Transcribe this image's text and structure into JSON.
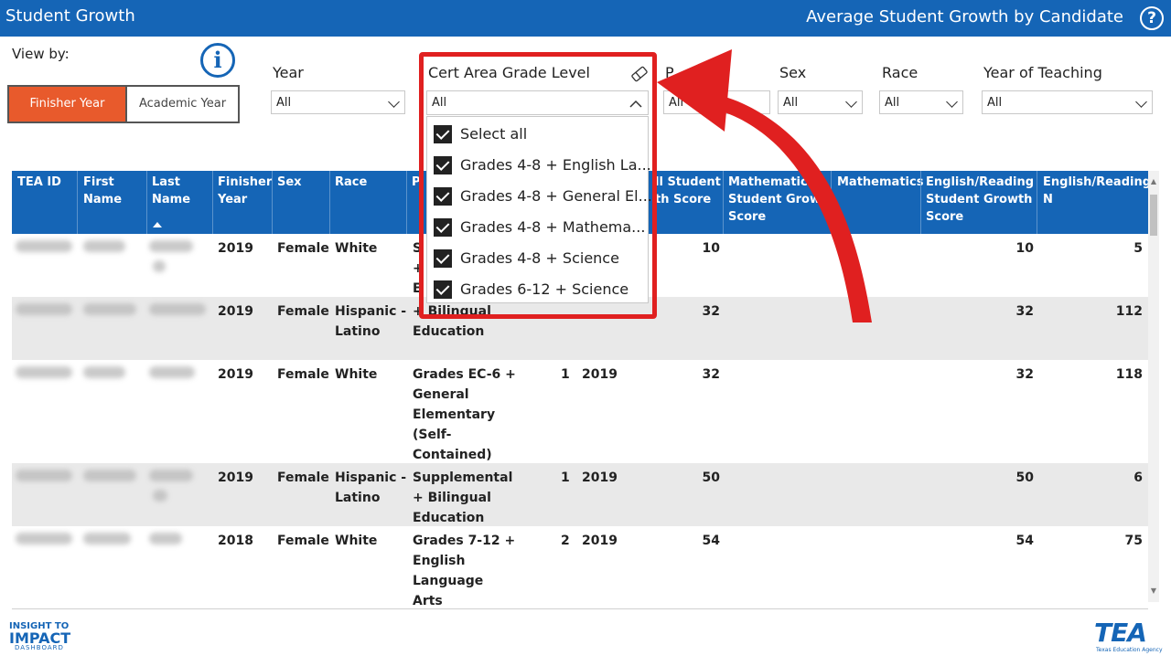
{
  "header": {
    "app_title": "Student Growth",
    "report_title": "Average Student Growth by Candidate",
    "help_glyph": "?"
  },
  "view_by": {
    "label": "View by:",
    "info_glyph": "i",
    "options": [
      {
        "label": "Finisher Year",
        "selected": true
      },
      {
        "label": "Academic Year",
        "selected": false
      }
    ]
  },
  "filters": {
    "year": {
      "label": "Year",
      "value": "All"
    },
    "cert_area": {
      "label": "Cert Area Grade Level",
      "value": "All"
    },
    "hidden_filter": {
      "label": "P",
      "value": "All"
    },
    "sex": {
      "label": "Sex",
      "value": "All"
    },
    "race": {
      "label": "Race",
      "value": "All"
    },
    "year_of_teaching": {
      "label": "Year of Teaching",
      "value": "All"
    }
  },
  "dropdown": {
    "items": [
      {
        "label": "Select all",
        "checked": true
      },
      {
        "label": "Grades 4-8 + English La...",
        "checked": true
      },
      {
        "label": "Grades 4-8 + General El...",
        "checked": true
      },
      {
        "label": "Grades 4-8 + Mathema...",
        "checked": true
      },
      {
        "label": "Grades 4-8 + Science",
        "checked": true
      },
      {
        "label": "Grades 6-12 + Science",
        "checked": true
      }
    ]
  },
  "table": {
    "headers": {
      "tea_id": [
        "TEA ID"
      ],
      "first_name": [
        "First",
        "Name"
      ],
      "last_name": [
        "Last",
        "Name"
      ],
      "finisher_year": [
        "Finisher",
        "Year"
      ],
      "sex": [
        "Sex"
      ],
      "race": [
        "Race"
      ],
      "program": [
        "P"
      ],
      "all_score": [
        "ll Student",
        "th Score"
      ],
      "math_score": [
        "Mathematics",
        "Student Growth",
        "Score"
      ],
      "math_n": [
        "Mathematics"
      ],
      "ela_score": [
        "English/Reading",
        "Student Growth",
        "Score"
      ],
      "ela_n": [
        "English/Reading",
        "N"
      ]
    },
    "rows": [
      {
        "finisher_year": "2019",
        "sex": "Female",
        "race": [
          "White"
        ],
        "program": [
          "S",
          "+",
          "E"
        ],
        "year_of_teaching": "",
        "academic_year": "",
        "all_score": "10",
        "ela_score": "10",
        "ela_n": "5"
      },
      {
        "finisher_year": "2019",
        "sex": "Female",
        "race": [
          "Hispanic -",
          "Latino"
        ],
        "program": [
          "",
          "+ Bilingual",
          "Education"
        ],
        "year_of_teaching": "",
        "academic_year": "",
        "all_score": "32",
        "ela_score": "32",
        "ela_n": "112"
      },
      {
        "finisher_year": "2019",
        "sex": "Female",
        "race": [
          "White"
        ],
        "program": [
          "Grades EC-6 +",
          "General",
          "Elementary",
          "(Self-",
          "Contained)"
        ],
        "year_of_teaching": "1",
        "academic_year": "2019",
        "all_score": "32",
        "ela_score": "32",
        "ela_n": "118"
      },
      {
        "finisher_year": "2019",
        "sex": "Female",
        "race": [
          "Hispanic -",
          "Latino"
        ],
        "program": [
          "Supplemental",
          "+ Bilingual",
          "Education"
        ],
        "year_of_teaching": "1",
        "academic_year": "2019",
        "all_score": "50",
        "ela_score": "50",
        "ela_n": "6"
      },
      {
        "finisher_year": "2018",
        "sex": "Female",
        "race": [
          "White"
        ],
        "program": [
          "Grades 7-12 +",
          "English",
          "Language",
          "Arts"
        ],
        "year_of_teaching": "2",
        "academic_year": "2019",
        "all_score": "54",
        "ela_score": "54",
        "ela_n": "75"
      }
    ]
  },
  "logos": {
    "insight": {
      "line1": "INSIGHT TO",
      "line2": "IMPACT",
      "line3": "DASHBOARD"
    },
    "tea": {
      "mark": "TEA",
      "subtitle": "Texas Education Agency"
    }
  },
  "colors": {
    "header_blue": "#1565b6",
    "accent_orange": "#e85a2c",
    "highlight_red": "#e02020"
  },
  "icons": {
    "help": "help-circle-icon",
    "info": "info-circle-icon",
    "eraser": "eraser-icon",
    "chevron_down": "chevron-down-icon",
    "chevron_up": "chevron-up-icon",
    "checkbox": "checkbox-checked-icon",
    "annotation_arrow": "red-curved-arrow-icon"
  }
}
